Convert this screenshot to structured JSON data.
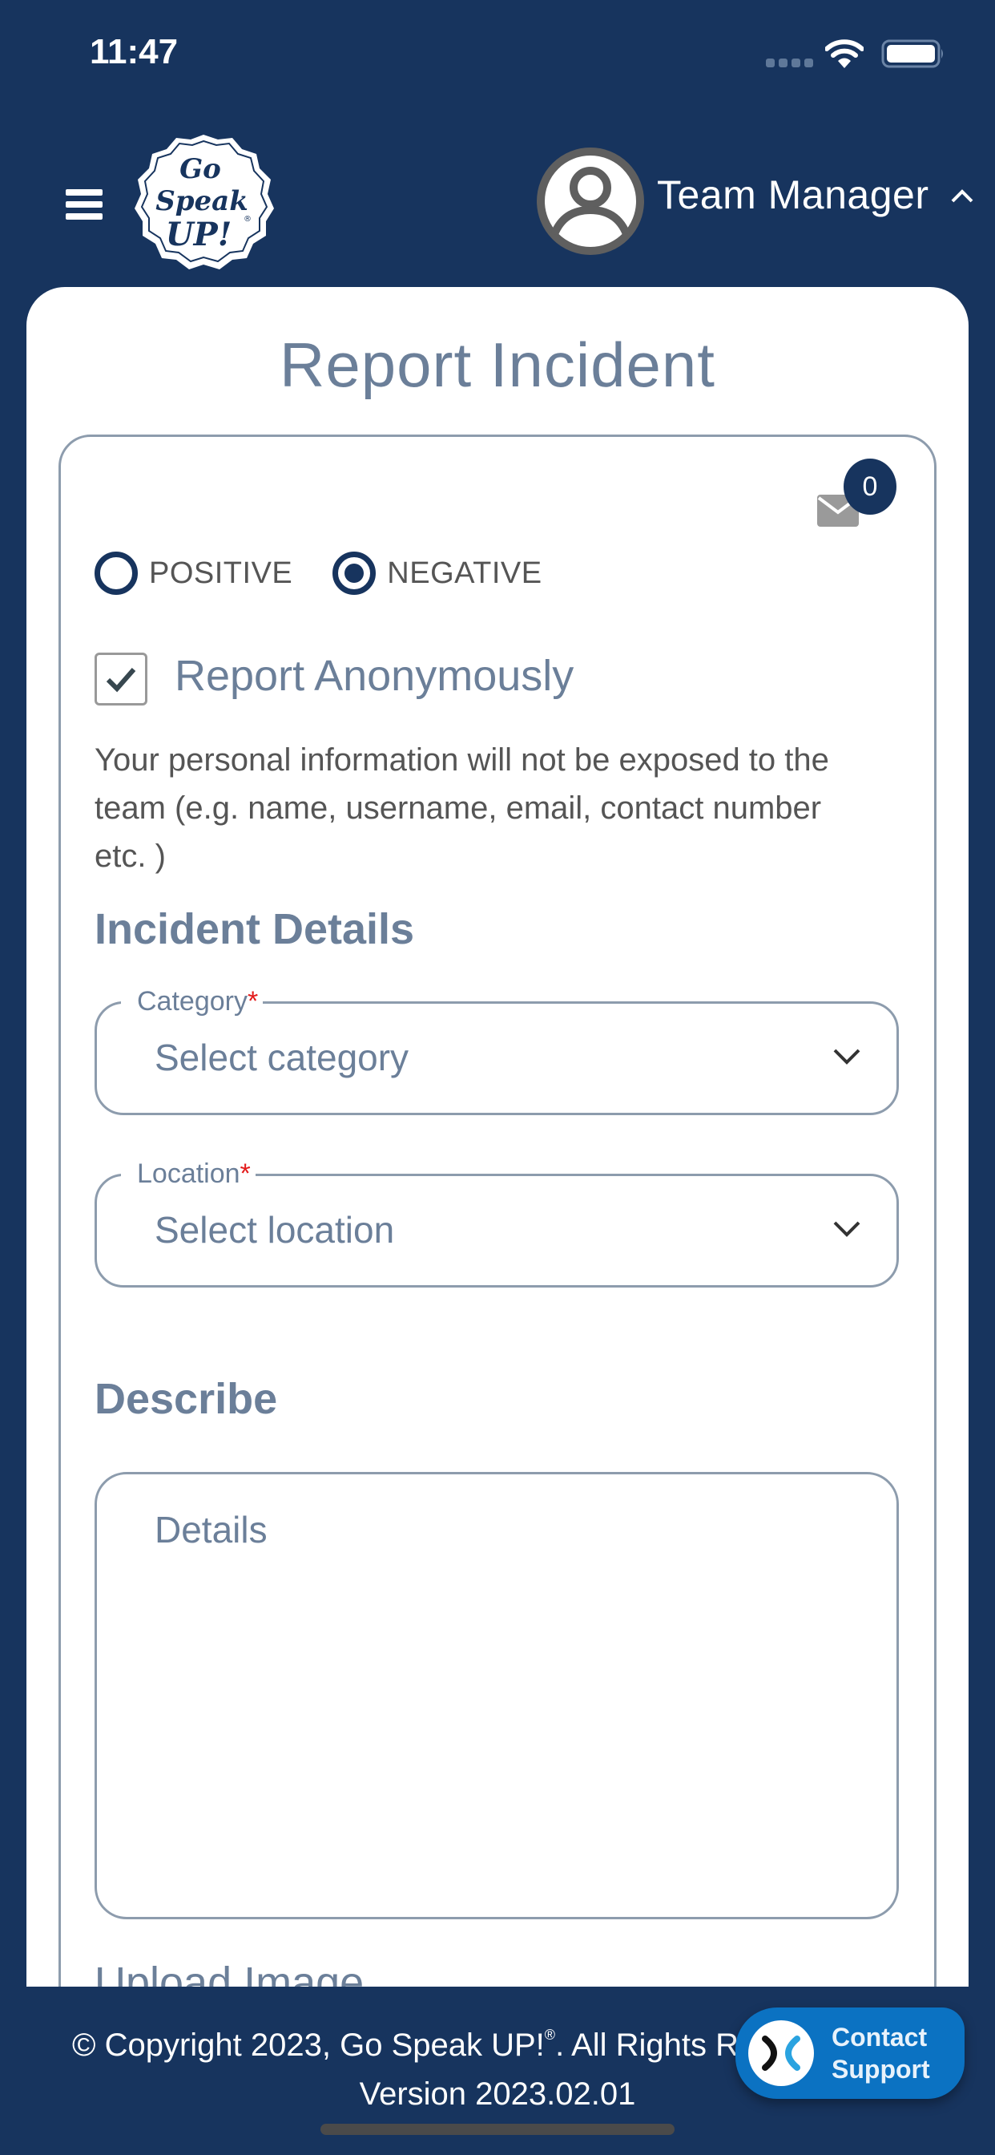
{
  "status_bar": {
    "time": "11:47"
  },
  "header": {
    "logo_alt": "Go Speak UP!",
    "logo_lines": [
      "Go",
      "Speak",
      "UP!"
    ],
    "profile_name": "Team Manager",
    "profile_caret": "^"
  },
  "page": {
    "title": "Report Incident"
  },
  "messages": {
    "unread_count": "0"
  },
  "report_type": {
    "options": [
      {
        "label": "POSITIVE",
        "selected": false
      },
      {
        "label": "NEGATIVE",
        "selected": true
      }
    ]
  },
  "anonymous": {
    "label": "Report Anonymously",
    "checked": true,
    "description": "Your personal information will not be exposed to the team (e.g. name, username, email, contact number etc. )"
  },
  "incident_details": {
    "heading": "Incident Details",
    "category": {
      "label": "Category",
      "required_mark": "*",
      "value": "Select category"
    },
    "location": {
      "label": "Location",
      "required_mark": "*",
      "value": "Select location"
    }
  },
  "describe": {
    "heading": "Describe",
    "placeholder": "Details"
  },
  "upload": {
    "heading": "Upload Image"
  },
  "footer": {
    "copyright": "© Copyright 2023, Go Speak UP!",
    "registered": "®",
    "rights": ".   All Rights Reserved",
    "version": "Version 2023.02.01"
  },
  "contact_support": {
    "line1": "Contact",
    "line2": "Support"
  },
  "colors": {
    "brand_navy": "#17345e",
    "accent_slate": "#6b7f99",
    "support_blue": "#0b72c2",
    "required_red": "#e31b1b"
  }
}
